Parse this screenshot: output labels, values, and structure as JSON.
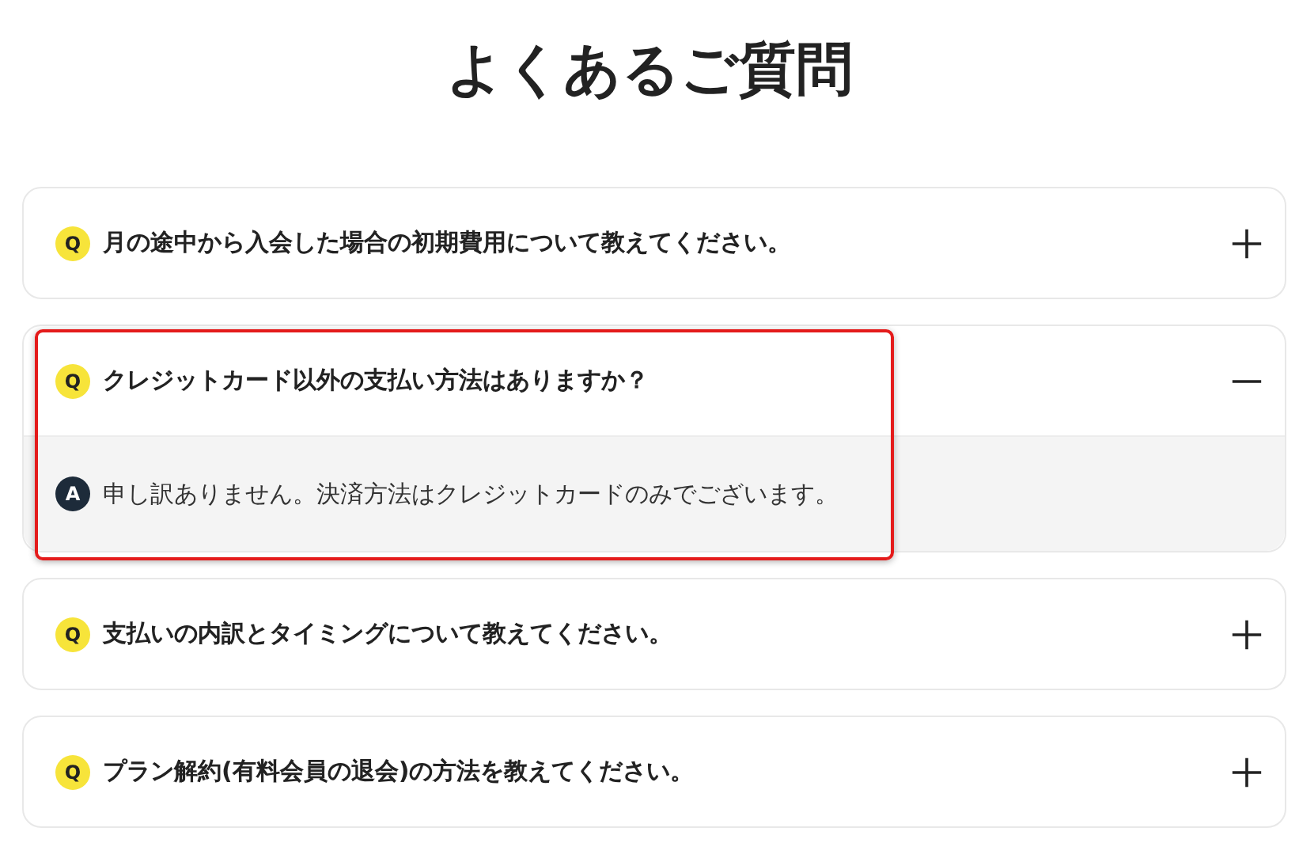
{
  "title": "よくあるご質問",
  "faq": [
    {
      "badge": "Q",
      "question": "月の途中から入会した場合の初期費用について教えてください。",
      "expanded": false,
      "highlighted": false
    },
    {
      "badge": "Q",
      "question": "クレジットカード以外の支払い方法はありますか？",
      "expanded": true,
      "highlighted": true,
      "answer_badge": "A",
      "answer": "申し訳ありません。決済方法はクレジットカードのみでございます。"
    },
    {
      "badge": "Q",
      "question": "支払いの内訳とタイミングについて教えてください。",
      "expanded": false,
      "highlighted": false
    },
    {
      "badge": "Q",
      "question": "プラン解約(有料会員の退会)の方法を教えてください。",
      "expanded": false,
      "highlighted": false
    }
  ]
}
